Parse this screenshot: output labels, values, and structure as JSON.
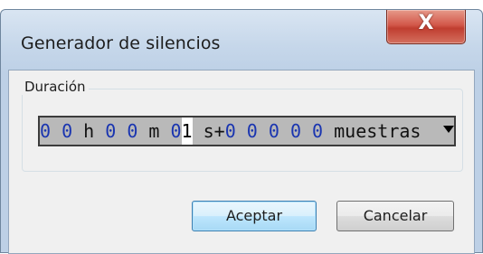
{
  "dialog": {
    "title": "Generador de silencios",
    "close_label": "X"
  },
  "group": {
    "label": "Duración"
  },
  "duration": {
    "hours_digits": "0 0",
    "hours_unit": " h ",
    "minutes_digits": "0 0",
    "minutes_unit": " m ",
    "seconds_digit_1": "0",
    "seconds_digit_2": "1",
    "seconds_unit": " s+",
    "samples_digits": "0 0 0 0 0",
    "samples_unit": " muestras"
  },
  "buttons": {
    "ok_label": "Aceptar",
    "cancel_label": "Cancelar"
  },
  "colors": {
    "digit": "#1a35b0",
    "field_background": "#b9b9b9",
    "default_button_border": "#3c7fb1"
  },
  "icons": {
    "close": "close-icon",
    "dropdown": "chevron-down-icon"
  }
}
